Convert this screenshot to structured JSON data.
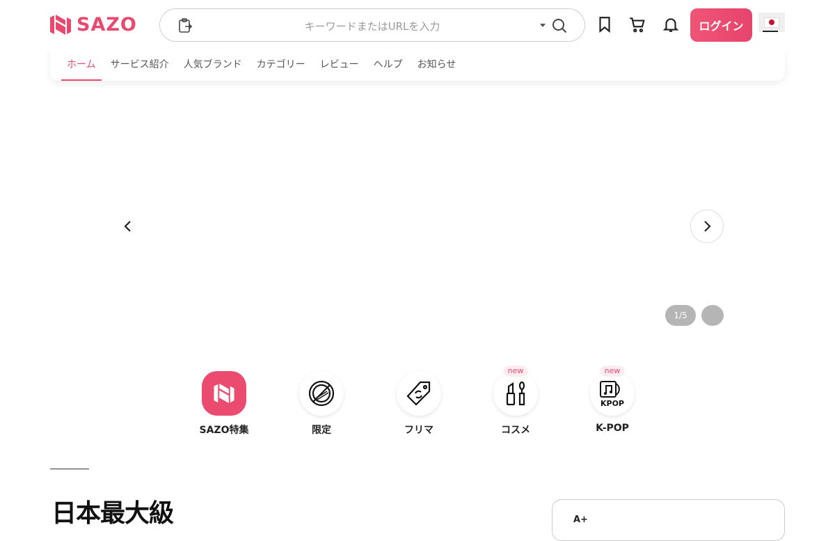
{
  "header": {
    "logo_text": "SAZO",
    "search_placeholder": "キーワードまたはURLを入力",
    "login_label": "ログイン",
    "icons": [
      "clipboard-icon",
      "dropdown-caret-icon",
      "search-icon",
      "bookmark-icon",
      "cart-icon",
      "bell-icon",
      "japan-flag-icon"
    ]
  },
  "nav": {
    "items": [
      {
        "label": "ホーム",
        "active": true
      },
      {
        "label": "サービス紹介",
        "active": false
      },
      {
        "label": "人気ブランド",
        "active": false
      },
      {
        "label": "カテゴリー",
        "active": false
      },
      {
        "label": "レビュー",
        "active": false
      },
      {
        "label": "ヘルプ",
        "active": false
      },
      {
        "label": "お知らせ",
        "active": false
      }
    ]
  },
  "carousel": {
    "pager": "1/5"
  },
  "categories": [
    {
      "label": "SAZO特集",
      "icon": "sazo-logo-icon",
      "badge": ""
    },
    {
      "label": "限定",
      "icon": "limited-icon",
      "badge": ""
    },
    {
      "label": "フリマ",
      "icon": "tag-icon",
      "badge": ""
    },
    {
      "label": "コスメ",
      "icon": "cosmetics-icon",
      "badge": "new"
    },
    {
      "label": "K-POP",
      "icon": "kpop-icon",
      "badge": "new"
    }
  ],
  "section": {
    "heading": "日本最大級",
    "side_card_text": "A+"
  },
  "colors": {
    "brand": "#e84a6f",
    "login_button": "#e6446c"
  }
}
